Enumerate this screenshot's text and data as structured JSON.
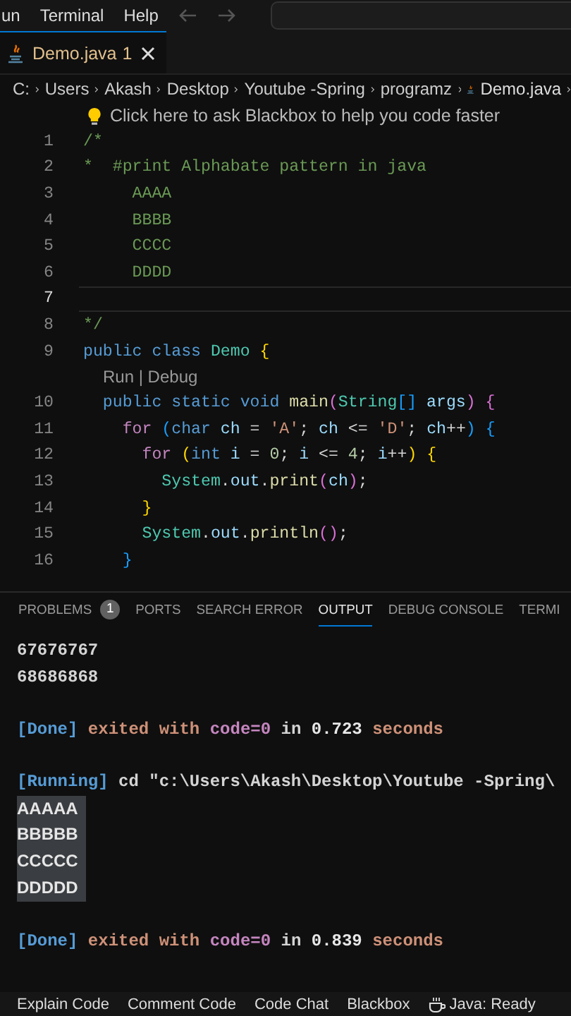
{
  "menu": [
    "un",
    "Terminal",
    "Help"
  ],
  "tabs": [
    {
      "label": "Demo.java",
      "badge": "1",
      "selected": true
    }
  ],
  "breadcrumbs": [
    {
      "label": "C:",
      "file": false
    },
    {
      "label": "Users",
      "file": false
    },
    {
      "label": "Akash",
      "file": false
    },
    {
      "label": "Desktop",
      "file": false
    },
    {
      "label": "Youtube -Spring",
      "file": false
    },
    {
      "label": "programz",
      "file": false
    },
    {
      "label": "Demo.java",
      "file": true
    }
  ],
  "hint": "Click here to ask Blackbox to help you code faster",
  "code": [
    {
      "kind": "code",
      "number": "1",
      "selected": false,
      "tokens": [
        {
          "text": "/*",
          "kind": "comment"
        }
      ]
    },
    {
      "kind": "code",
      "number": "2",
      "selected": false,
      "tokens": [
        {
          "text": "*  #print Alphabate pattern in java",
          "kind": "comment"
        }
      ]
    },
    {
      "kind": "code",
      "number": "3",
      "selected": false,
      "tokens": [
        {
          "text": "     AAAA",
          "kind": "comment"
        }
      ]
    },
    {
      "kind": "code",
      "number": "4",
      "selected": false,
      "tokens": [
        {
          "text": "     BBBB",
          "kind": "comment"
        }
      ]
    },
    {
      "kind": "code",
      "number": "5",
      "selected": false,
      "tokens": [
        {
          "text": "     CCCC",
          "kind": "comment"
        }
      ]
    },
    {
      "kind": "code",
      "number": "6",
      "selected": false,
      "tokens": [
        {
          "text": "     DDDD",
          "kind": "comment"
        }
      ]
    },
    {
      "kind": "code",
      "number": "7",
      "selected": true
    },
    {
      "kind": "code",
      "number": "8",
      "selected": false,
      "tokens": [
        {
          "text": "*/",
          "kind": "comment"
        }
      ]
    },
    {
      "kind": "code",
      "number": "9",
      "selected": false,
      "tokens": [
        {
          "text": "public class",
          "kind": "kw"
        },
        {
          "text": " Demo",
          "kind": "type"
        },
        {
          "text": " {",
          "kind": "b1"
        }
      ]
    },
    {
      "kind": "codelens",
      "text": "Run | Debug"
    },
    {
      "kind": "code",
      "number": "10",
      "selected": false,
      "tokens": [
        {
          "text": "  public static void",
          "kind": "kw"
        },
        {
          "text": " main",
          "kind": "fn"
        },
        {
          "text": "(",
          "kind": "b2"
        },
        {
          "text": "String",
          "kind": "type"
        },
        {
          "text": "[]",
          "kind": "b3"
        },
        {
          "text": " args",
          "kind": "var"
        },
        {
          "text": ") {",
          "kind": "b2"
        }
      ]
    },
    {
      "kind": "code",
      "number": "11",
      "selected": false,
      "tokens": [
        {
          "text": "    for",
          "kind": "ctl"
        },
        {
          "text": " (",
          "kind": "b3"
        },
        {
          "text": "char",
          "kind": "kw"
        },
        {
          "text": " ch",
          "kind": "var"
        },
        {
          "text": " = ",
          "kind": "op"
        },
        {
          "text": "'A'",
          "kind": "str"
        },
        {
          "text": ";",
          "kind": "op"
        },
        {
          "text": " ch",
          "kind": "var"
        },
        {
          "text": " <= ",
          "kind": "op"
        },
        {
          "text": "'D'",
          "kind": "str"
        },
        {
          "text": ";",
          "kind": "op"
        },
        {
          "text": " ch",
          "kind": "var"
        },
        {
          "text": "++",
          "kind": "op"
        },
        {
          "text": ") {",
          "kind": "b3"
        }
      ]
    },
    {
      "kind": "code",
      "number": "12",
      "selected": false,
      "tokens": [
        {
          "text": "      for",
          "kind": "ctl"
        },
        {
          "text": " (",
          "kind": "b1"
        },
        {
          "text": "int",
          "kind": "kw"
        },
        {
          "text": " i",
          "kind": "var"
        },
        {
          "text": " = ",
          "kind": "op"
        },
        {
          "text": "0",
          "kind": "num"
        },
        {
          "text": ";",
          "kind": "op"
        },
        {
          "text": " i",
          "kind": "var"
        },
        {
          "text": " <= ",
          "kind": "op"
        },
        {
          "text": "4",
          "kind": "num"
        },
        {
          "text": ";",
          "kind": "op"
        },
        {
          "text": " i",
          "kind": "var"
        },
        {
          "text": "++",
          "kind": "op"
        },
        {
          "text": ") {",
          "kind": "b1"
        }
      ]
    },
    {
      "kind": "code",
      "number": "13",
      "selected": false,
      "tokens": [
        {
          "text": "        System",
          "kind": "type"
        },
        {
          "text": ".",
          "kind": "op"
        },
        {
          "text": "out",
          "kind": "var"
        },
        {
          "text": ".",
          "kind": "op"
        },
        {
          "text": "print",
          "kind": "fn"
        },
        {
          "text": "(",
          "kind": "b2"
        },
        {
          "text": "ch",
          "kind": "var"
        },
        {
          "text": ")",
          "kind": "b2"
        },
        {
          "text": ";",
          "kind": "op"
        }
      ]
    },
    {
      "kind": "code",
      "number": "14",
      "selected": false,
      "tokens": [
        {
          "text": "      }",
          "kind": "b1"
        }
      ]
    },
    {
      "kind": "code",
      "number": "15",
      "selected": false,
      "tokens": [
        {
          "text": "      System",
          "kind": "type"
        },
        {
          "text": ".",
          "kind": "op"
        },
        {
          "text": "out",
          "kind": "var"
        },
        {
          "text": ".",
          "kind": "op"
        },
        {
          "text": "println",
          "kind": "fn"
        },
        {
          "text": "()",
          "kind": "b2"
        },
        {
          "text": ";",
          "kind": "op"
        }
      ]
    },
    {
      "kind": "code",
      "number": "16",
      "selected": false,
      "tokens": [
        {
          "text": "    }",
          "kind": "b3"
        }
      ]
    }
  ],
  "panel_tabs": [
    {
      "label": "PROBLEMS",
      "badge": "1",
      "selected": false
    },
    {
      "label": "PORTS",
      "selected": false
    },
    {
      "label": "SEARCH ERROR",
      "selected": false
    },
    {
      "label": "OUTPUT",
      "selected": true
    },
    {
      "label": "DEBUG CONSOLE",
      "selected": false
    },
    {
      "label": "TERMI",
      "selected": false
    }
  ],
  "output": [
    {
      "kind": "text",
      "selected": false,
      "segments": [
        {
          "text": "67676767",
          "kind": "plain"
        }
      ]
    },
    {
      "kind": "text",
      "selected": false,
      "segments": [
        {
          "text": "68686868",
          "kind": "plain"
        }
      ]
    },
    {
      "kind": "gap"
    },
    {
      "kind": "text",
      "selected": false,
      "segments": [
        {
          "text": "[Done]",
          "kind": "tag"
        },
        {
          "text": " exited with ",
          "kind": "msg"
        },
        {
          "text": "code=0",
          "kind": "code"
        },
        {
          "text": " in ",
          "kind": "plain"
        },
        {
          "text": "0.723",
          "kind": "num"
        },
        {
          "text": " seconds",
          "kind": "msg"
        }
      ]
    },
    {
      "kind": "gap"
    },
    {
      "kind": "text",
      "selected": false,
      "segments": [
        {
          "text": "[Running]",
          "kind": "tag"
        },
        {
          "text": " cd \"c:\\Users\\Akash\\Desktop\\Youtube -Spring\\",
          "kind": "plain"
        }
      ]
    },
    {
      "kind": "text",
      "selected": true,
      "segments": [
        {
          "text": "AAAAA",
          "kind": "result"
        }
      ]
    },
    {
      "kind": "text",
      "selected": true,
      "segments": [
        {
          "text": "BBBBB",
          "kind": "result"
        }
      ]
    },
    {
      "kind": "text",
      "selected": true,
      "segments": [
        {
          "text": "CCCCC",
          "kind": "result"
        }
      ]
    },
    {
      "kind": "text",
      "selected": true,
      "segments": [
        {
          "text": "DDDDD",
          "kind": "result"
        }
      ]
    },
    {
      "kind": "gap"
    },
    {
      "kind": "text",
      "selected": false,
      "segments": [
        {
          "text": "[Done]",
          "kind": "tag"
        },
        {
          "text": " exited with ",
          "kind": "msg"
        },
        {
          "text": "code=0",
          "kind": "code"
        },
        {
          "text": " in ",
          "kind": "plain"
        },
        {
          "text": "0.839",
          "kind": "num"
        },
        {
          "text": " seconds",
          "kind": "msg"
        }
      ]
    }
  ],
  "status_bar": [
    {
      "label": "Explain Code",
      "kind": "text"
    },
    {
      "label": "Comment Code",
      "kind": "text"
    },
    {
      "label": "Code Chat",
      "kind": "text"
    },
    {
      "label": "Blackbox",
      "kind": "text"
    },
    {
      "label": "Java: Ready",
      "kind": "java"
    }
  ]
}
